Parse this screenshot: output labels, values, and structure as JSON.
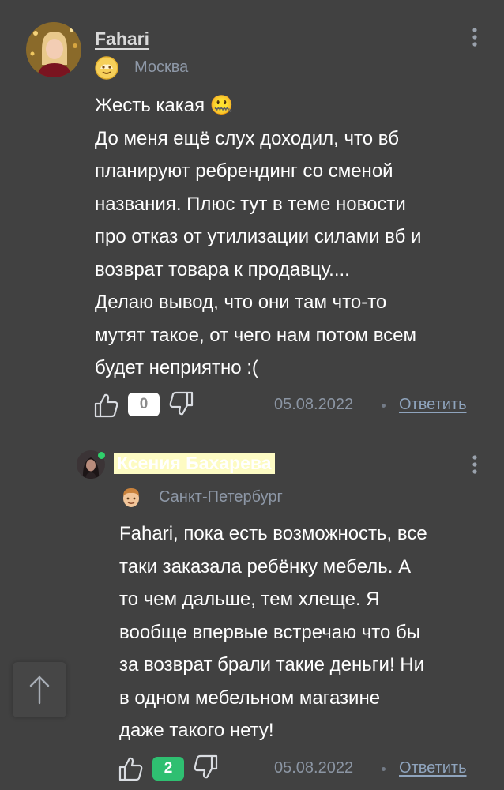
{
  "comments": [
    {
      "author": "Fahari",
      "city": "Москва",
      "badge_icon": "sun-face-badge-icon",
      "lines": [
        "Жесть какая 🤐",
        "До меня ещё слух доходил, что вб",
        "планируют ребрендинг со сменой",
        "названия. Плюс тут в теме новости",
        "про отказ от утилизации силами вб и",
        "возврат товара к продавцу....",
        "Делаю вывод, что они там что-то",
        "мутят такое, от чего нам потом всем",
        "будет неприятно :("
      ],
      "likes": "0",
      "date": "05.08.2022",
      "reply_label": "Ответить"
    },
    {
      "author": "Ксения Бахарева",
      "city": "Санкт-Петербург",
      "badge_icon": "boy-face-badge-icon",
      "online": true,
      "lines": [
        "Fahari, пока есть возможность, все",
        "таки заказала ребёнку мебель. А",
        "то чем дальше, тем хлеще. Я",
        "вообще впервые встречаю что бы",
        "за возврат брали такие деньги! Ни",
        "в одном мебельном магазине",
        "даже такого нету!"
      ],
      "likes": "2",
      "date": "05.08.2022",
      "reply_label": "Ответить"
    }
  ],
  "colors": {
    "background": "#414141",
    "author_highlight": "#fdfbc3",
    "positive_count": "#2fbf71",
    "online_dot": "#2fd06b",
    "reply_link": "#8fa4bd"
  },
  "icons": [
    "kebab-menu-icon",
    "thumb-up-icon",
    "thumb-down-icon",
    "arrow-up-icon"
  ]
}
